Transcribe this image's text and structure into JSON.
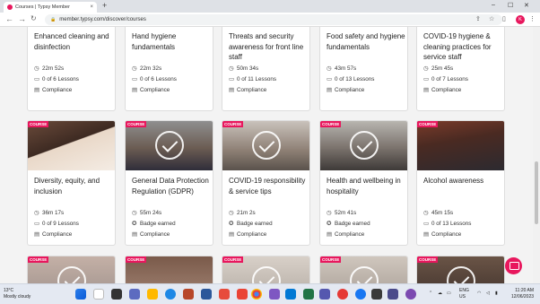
{
  "browser": {
    "tab_title": "Courses | Typsy Member",
    "tab_close": "×",
    "new_tab": "+",
    "url": "member.typsy.com/discover/courses",
    "profile_initial": "K",
    "window_controls": [
      "–",
      "☐",
      "✕"
    ]
  },
  "badge_label": "COURSE",
  "rows": [
    [
      {
        "title": "Enhanced cleaning and disinfection",
        "duration": "22m 52s",
        "progress": "0 of 6 Lessons",
        "category": "Compliance"
      },
      {
        "title": "Hand hygiene fundamentals",
        "duration": "22m 32s",
        "progress": "0 of 6 Lessons",
        "category": "Compliance"
      },
      {
        "title": "Threats and security awareness for front line staff",
        "duration": "50m 34s",
        "progress": "0 of 11 Lessons",
        "category": "Compliance"
      },
      {
        "title": "Food safety and hygiene fundamentals",
        "duration": "43m 57s",
        "progress": "0 of 13 Lessons",
        "category": "Compliance"
      },
      {
        "title": "COVID-19 hygiene & cleaning practices for service staff",
        "duration": "25m 45s",
        "progress": "0 of 7 Lessons",
        "category": "Compliance"
      }
    ],
    [
      {
        "title": "Diversity, equity, and inclusion",
        "duration": "36m 17s",
        "progress": "0 of 9 Lessons",
        "category": "Compliance",
        "completed": false
      },
      {
        "title": "General Data Protection Regulation (GDPR)",
        "duration": "55m 24s",
        "progress": "Badge earned",
        "category": "Compliance",
        "completed": true
      },
      {
        "title": "COVID-19 responsibility & service tips",
        "duration": "21m 2s",
        "progress": "Badge earned",
        "category": "Compliance",
        "completed": true
      },
      {
        "title": "Health and wellbeing in hospitality",
        "duration": "52m 41s",
        "progress": "Badge earned",
        "category": "Compliance",
        "completed": true
      },
      {
        "title": "Alcohol awareness",
        "duration": "45m 15s",
        "progress": "0 of 13 Lessons",
        "category": "Compliance",
        "completed": false
      }
    ]
  ],
  "taskbar": {
    "weather_temp": "13°C",
    "weather_desc": "Mostly cloudy",
    "lang_top": "ENG",
    "lang_bottom": "US",
    "time": "11:20 AM",
    "date": "12/06/2023"
  },
  "colors": {
    "accent": "#e8175d"
  }
}
